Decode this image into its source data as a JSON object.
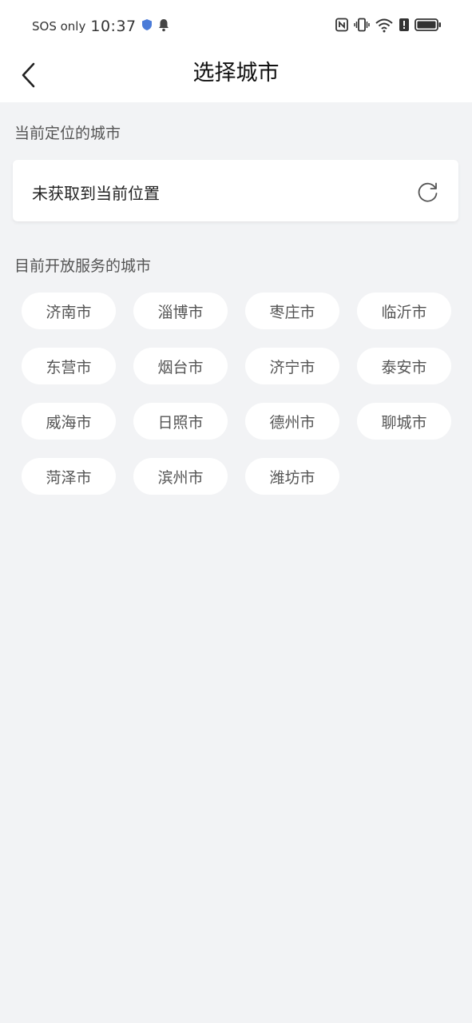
{
  "status_bar": {
    "carrier": "SOS only",
    "time": "10:37"
  },
  "nav": {
    "title": "选择城市"
  },
  "current_location": {
    "section_label": "当前定位的城市",
    "status_text": "未获取到当前位置"
  },
  "service_cities": {
    "section_label": "目前开放服务的城市",
    "items": [
      {
        "label": "济南市"
      },
      {
        "label": "淄博市"
      },
      {
        "label": "枣庄市"
      },
      {
        "label": "临沂市"
      },
      {
        "label": "东营市"
      },
      {
        "label": "烟台市"
      },
      {
        "label": "济宁市"
      },
      {
        "label": "泰安市"
      },
      {
        "label": "威海市"
      },
      {
        "label": "日照市"
      },
      {
        "label": "德州市"
      },
      {
        "label": "聊城市"
      },
      {
        "label": "菏泽市"
      },
      {
        "label": "滨州市"
      },
      {
        "label": "潍坊市"
      }
    ]
  }
}
